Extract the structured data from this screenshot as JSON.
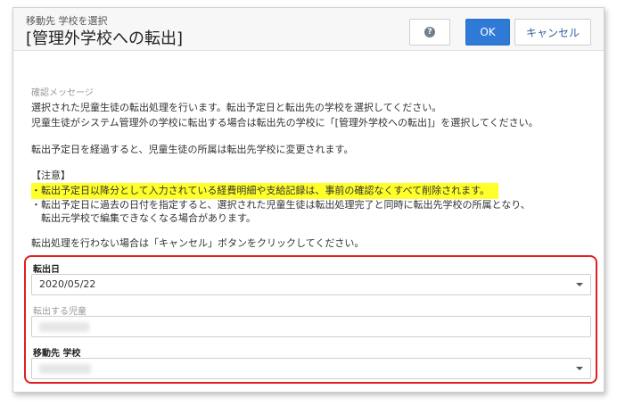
{
  "header": {
    "subtitle": "移動先 学校を選択",
    "title": "[管理外学校への転出]",
    "ok_label": "OK",
    "cancel_label": "キャンセル",
    "help_glyph": "?"
  },
  "message": {
    "caption": "確認メッセージ",
    "line1": "選択された児童生徒の転出処理を行います。転出予定日と転出先の学校を選択してください。",
    "line2": "児童生徒がシステム管理外の学校に転出する場合は転出先の学校に「[管理外学校への転出]」を選択してください。",
    "line3": "転出予定日を経過すると、児童生徒の所属は転出先学校に変更されます。",
    "note_heading": "【注意】",
    "note1": "・転出予定日以降分として入力されている経費明細や支給記録は、事前の確認なくすべて削除されます。",
    "note2": "・転出予定日に過去の日付を指定すると、選択された児童生徒は転出処理完了と同時に転出先学校の所属となり、",
    "note3": "　転出元学校で編集できなくなる場合があります。",
    "line4": "転出処理を行わない場合は「キャンセル」ボタンをクリックしてください。"
  },
  "form": {
    "date_label": "転出日",
    "date_value": "2020/05/22",
    "student_label": "転出する児童",
    "school_label": "移動先 学校"
  },
  "colors": {
    "highlight": "#ffff2a",
    "annotation_box": "#e02020",
    "ok_button": "#2f7ad7"
  }
}
